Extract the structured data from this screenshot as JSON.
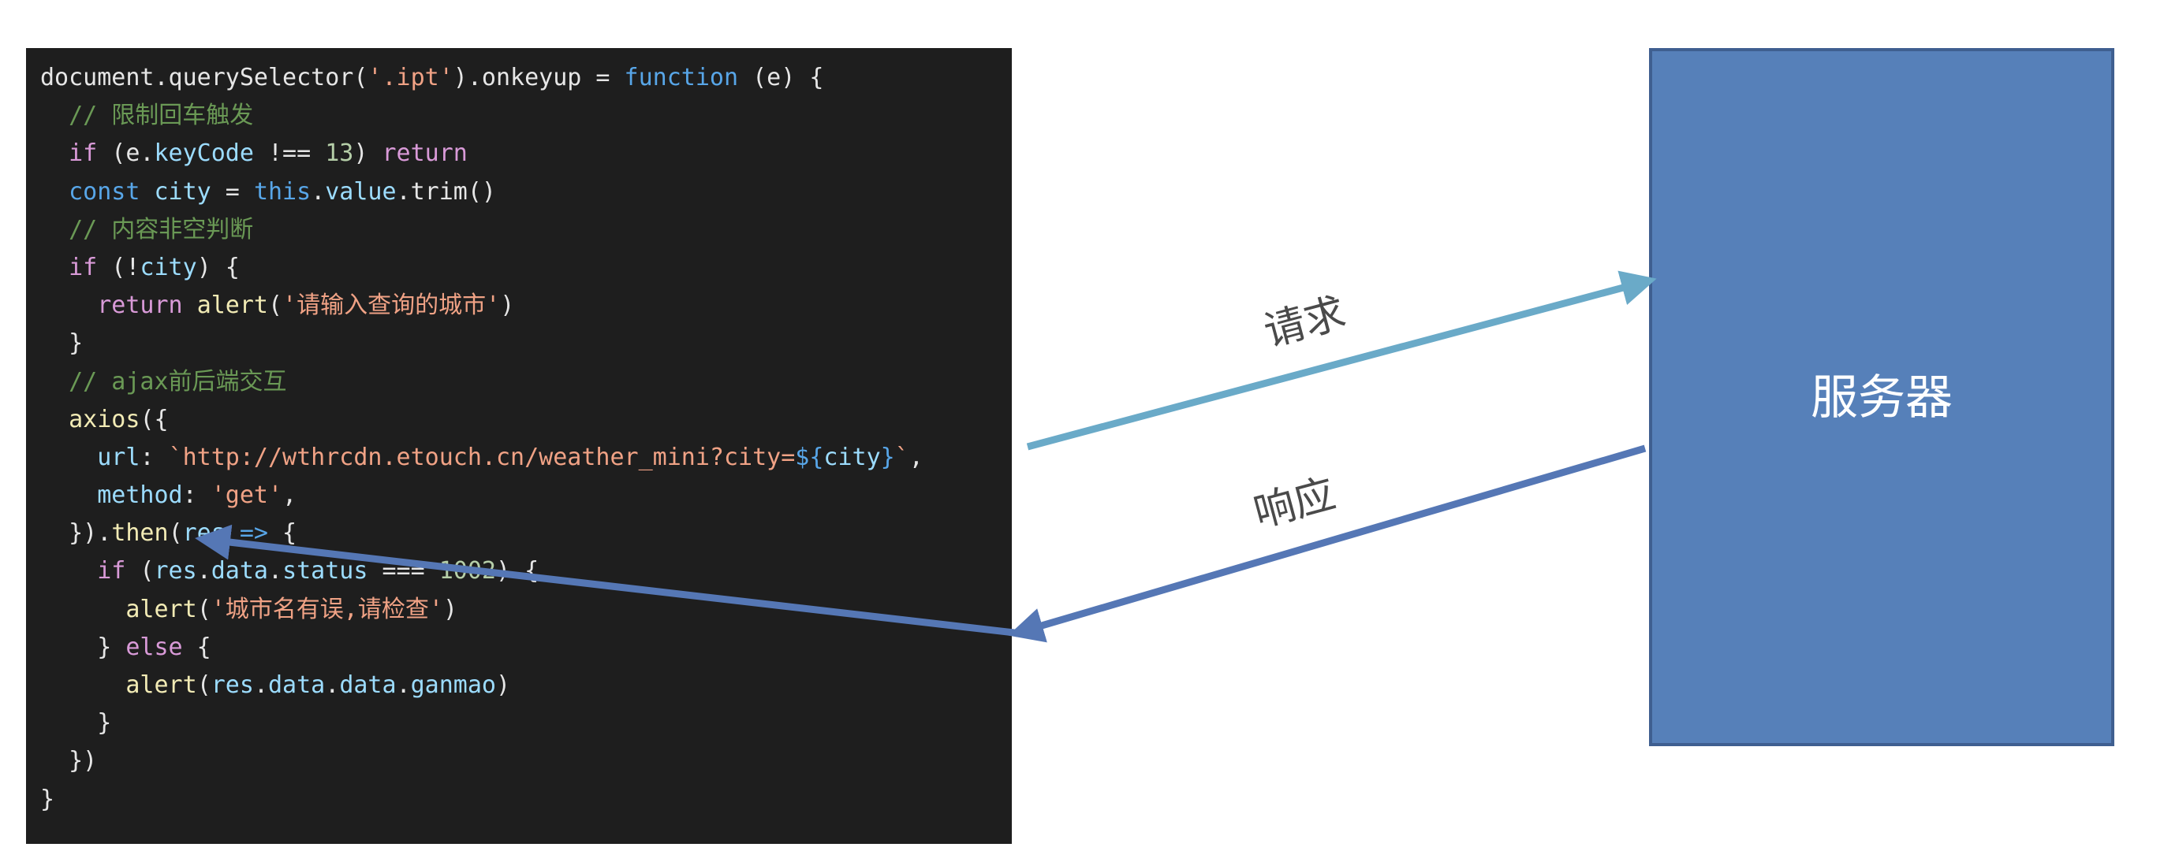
{
  "code": {
    "lines": [
      [
        [
          "plain",
          "document.querySelector("
        ],
        [
          "string",
          "'.ipt'"
        ],
        [
          "plain",
          ").onkeyup = "
        ],
        [
          "builtin",
          "function"
        ],
        [
          "plain",
          " (e) {"
        ]
      ],
      [
        [
          "plain",
          "  "
        ],
        [
          "comment",
          "// 限制回车触发"
        ]
      ],
      [
        [
          "plain",
          "  "
        ],
        [
          "keyword",
          "if"
        ],
        [
          "plain",
          " (e."
        ],
        [
          "prop",
          "keyCode"
        ],
        [
          "plain",
          " !== "
        ],
        [
          "number",
          "13"
        ],
        [
          "plain",
          ") "
        ],
        [
          "keyword",
          "return"
        ]
      ],
      [
        [
          "plain",
          "  "
        ],
        [
          "builtin",
          "const"
        ],
        [
          "plain",
          " "
        ],
        [
          "prop",
          "city"
        ],
        [
          "plain",
          " = "
        ],
        [
          "builtin",
          "this"
        ],
        [
          "plain",
          "."
        ],
        [
          "prop",
          "value"
        ],
        [
          "plain",
          ".trim()"
        ]
      ],
      [
        [
          "plain",
          "  "
        ],
        [
          "comment",
          "// 内容非空判断"
        ]
      ],
      [
        [
          "plain",
          "  "
        ],
        [
          "keyword",
          "if"
        ],
        [
          "plain",
          " (!"
        ],
        [
          "prop",
          "city"
        ],
        [
          "plain",
          ") {"
        ]
      ],
      [
        [
          "plain",
          "    "
        ],
        [
          "keyword",
          "return"
        ],
        [
          "plain",
          " "
        ],
        [
          "func",
          "alert"
        ],
        [
          "plain",
          "("
        ],
        [
          "string",
          "'请输入查询的城市'"
        ],
        [
          "plain",
          ")"
        ]
      ],
      [
        [
          "plain",
          "  }"
        ]
      ],
      [
        [
          "plain",
          "  "
        ],
        [
          "comment",
          "// ajax前后端交互"
        ]
      ],
      [
        [
          "plain",
          "  "
        ],
        [
          "func",
          "axios"
        ],
        [
          "plain",
          "({"
        ]
      ],
      [
        [
          "plain",
          "    "
        ],
        [
          "prop",
          "url"
        ],
        [
          "plain",
          ": "
        ],
        [
          "string",
          "`http://wthrcdn.etouch.cn/weather_mini?city="
        ],
        [
          "builtin",
          "${"
        ],
        [
          "prop",
          "city"
        ],
        [
          "builtin",
          "}"
        ],
        [
          "string",
          "`"
        ],
        [
          "plain",
          ","
        ]
      ],
      [
        [
          "plain",
          "    "
        ],
        [
          "prop",
          "method"
        ],
        [
          "plain",
          ": "
        ],
        [
          "string",
          "'get'"
        ],
        [
          "plain",
          ","
        ]
      ],
      [
        [
          "plain",
          "  })."
        ],
        [
          "func",
          "then"
        ],
        [
          "plain",
          "("
        ],
        [
          "prop",
          "res"
        ],
        [
          "plain",
          " "
        ],
        [
          "builtin",
          "=>"
        ],
        [
          "plain",
          " {"
        ]
      ],
      [
        [
          "plain",
          "    "
        ],
        [
          "keyword",
          "if"
        ],
        [
          "plain",
          " ("
        ],
        [
          "prop",
          "res"
        ],
        [
          "plain",
          "."
        ],
        [
          "prop",
          "data"
        ],
        [
          "plain",
          "."
        ],
        [
          "prop",
          "status"
        ],
        [
          "plain",
          " === "
        ],
        [
          "number",
          "1002"
        ],
        [
          "plain",
          ") {"
        ]
      ],
      [
        [
          "plain",
          "      "
        ],
        [
          "func",
          "alert"
        ],
        [
          "plain",
          "("
        ],
        [
          "string",
          "'城市名有误,请检查'"
        ],
        [
          "plain",
          ")"
        ]
      ],
      [
        [
          "plain",
          "    } "
        ],
        [
          "keyword",
          "else"
        ],
        [
          "plain",
          " {"
        ]
      ],
      [
        [
          "plain",
          "      "
        ],
        [
          "func",
          "alert"
        ],
        [
          "plain",
          "("
        ],
        [
          "prop",
          "res"
        ],
        [
          "plain",
          "."
        ],
        [
          "prop",
          "data"
        ],
        [
          "plain",
          "."
        ],
        [
          "prop",
          "data"
        ],
        [
          "plain",
          "."
        ],
        [
          "prop",
          "ganmao"
        ],
        [
          "plain",
          ")"
        ]
      ],
      [
        [
          "plain",
          "    }"
        ]
      ],
      [
        [
          "plain",
          "  })"
        ]
      ],
      [
        [
          "plain",
          "}"
        ]
      ]
    ]
  },
  "diagram": {
    "server_label": "服务器",
    "request_label": "请求",
    "response_label": "响应",
    "colors": {
      "request_arrow": "#6aaac8",
      "response_arrow": "#5577b5",
      "server_fill": "#5680b9",
      "server_border": "#3f5f90",
      "code_background": "#1e1e1e",
      "label_text": "#4a4a4a"
    }
  }
}
